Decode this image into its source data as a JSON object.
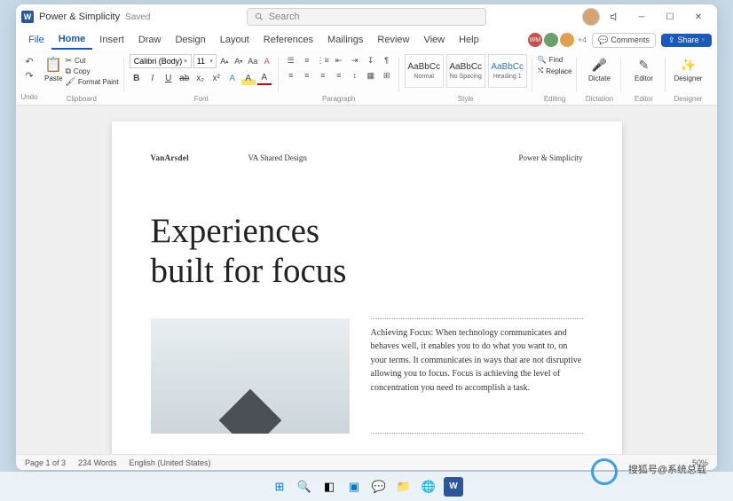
{
  "titlebar": {
    "app_letter": "W",
    "title": "Power & Simplicity",
    "saved": "Saved",
    "search_placeholder": "Search"
  },
  "tabs": {
    "file": "File",
    "items": [
      "Home",
      "Insert",
      "Draw",
      "Design",
      "Layout",
      "References",
      "Mailings",
      "Review",
      "View",
      "Help"
    ],
    "active_index": 0,
    "presence_more": "+4",
    "comments": "Comments",
    "share": "Share"
  },
  "ribbon": {
    "undo": "Undo",
    "clipboard": {
      "label": "Clipboard",
      "paste": "Paste",
      "cut": "Cut",
      "copy": "Copy",
      "format_paint": "Format Paint"
    },
    "font": {
      "label": "Font",
      "name": "Calibri (Body)",
      "size": "11"
    },
    "paragraph": {
      "label": "Paragraph"
    },
    "styles": {
      "label": "Style",
      "items": [
        {
          "preview": "AaBbCc",
          "name": "Normal"
        },
        {
          "preview": "AaBbCc",
          "name": "No Spacing"
        },
        {
          "preview": "AaBbCc",
          "name": "Heading 1"
        }
      ]
    },
    "editing": {
      "label": "Editing",
      "find": "Find",
      "replace": "Replace"
    },
    "dictation": {
      "label": "Dictation",
      "btn": "Dictate"
    },
    "editor": {
      "label": "Editor",
      "btn": "Editor"
    },
    "designer": {
      "label": "Designer",
      "btn": "Designer"
    }
  },
  "doc": {
    "brand": "VanArsdel",
    "sub": "VA Shared Design",
    "header_right": "Power & Simplicity",
    "title_line1": "Experiences",
    "title_line2": "built for focus",
    "body": "Achieving Focus: When technology communicates and behaves well, it enables you to do what you want to, on your terms. It communicates in ways that are not disruptive allowing you to focus. Focus is achieving the level of concentration you need to accomplish a task."
  },
  "status": {
    "page": "Page 1 of 3",
    "words": "234 Words",
    "lang": "English (United States)",
    "zoom": "50%"
  },
  "watermark": "搜狐号@系统总载"
}
